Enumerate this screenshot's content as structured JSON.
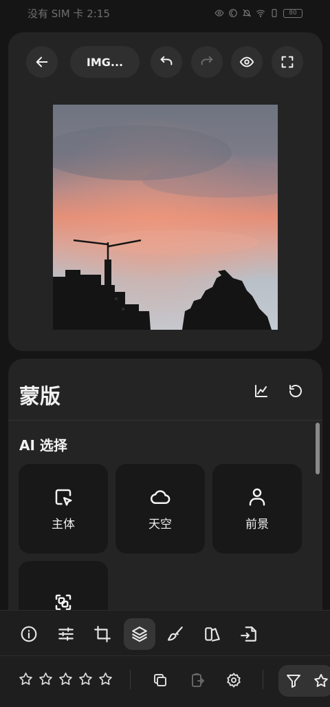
{
  "status_bar": {
    "carrier_time": "没有 SIM 卡 2:15",
    "battery": "80",
    "icons": [
      "eye-icon",
      "do-not-disturb-icon",
      "mute-icon",
      "wifi-icon",
      "vibrate-icon",
      "battery-icon"
    ]
  },
  "header": {
    "back_icon": "arrow-left-icon",
    "file_name": "IMG...",
    "undo_icon": "undo-icon",
    "redo_icon": "redo-icon",
    "preview_icon": "eye-icon",
    "fullscreen_icon": "fullscreen-icon"
  },
  "panel": {
    "title": "蒙版",
    "histogram_icon": "histogram-icon",
    "reset_icon": "reset-icon",
    "section_title": "AI 选择",
    "tiles": [
      {
        "label": "主体",
        "icon": "subject-select-icon"
      },
      {
        "label": "天空",
        "icon": "cloud-icon"
      },
      {
        "label": "前景",
        "icon": "person-icon"
      },
      {
        "label": "",
        "icon": "object-select-icon"
      }
    ]
  },
  "tools": {
    "items": [
      "info-icon",
      "adjust-sliders-icon",
      "crop-icon",
      "layers-icon",
      "brush-icon",
      "presets-icon",
      "export-icon"
    ],
    "active": "layers-icon"
  },
  "bottom": {
    "rating_stars": 5,
    "rating_value": 0,
    "copy_icon": "copy-icon",
    "paste_icon": "paste-icon",
    "settings_icon": "gear-icon",
    "filter_icon": "filter-icon"
  },
  "colors": {
    "background": "#151515",
    "card": "#242424",
    "tile": "#181818",
    "text": "#f2f2f2"
  }
}
